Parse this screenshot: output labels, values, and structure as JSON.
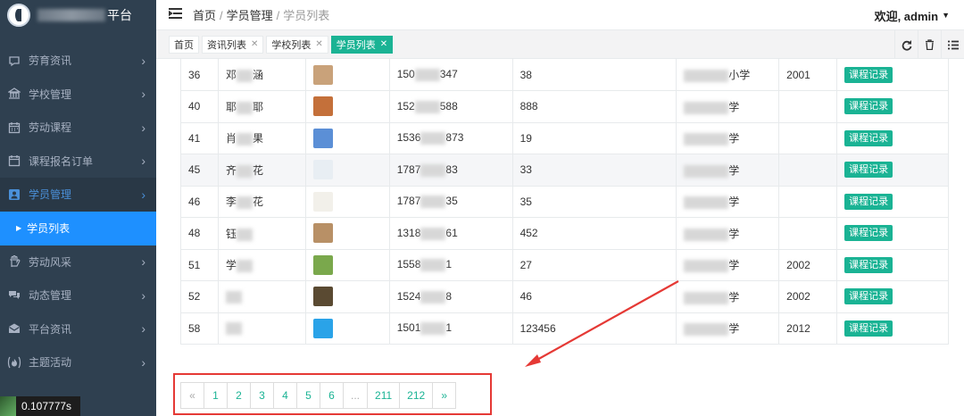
{
  "brand": {
    "title_suffix": "平台"
  },
  "sidebar": {
    "items": [
      {
        "label": "劳育资讯",
        "icon": "chat-bubble-icon"
      },
      {
        "label": "学校管理",
        "icon": "bank-icon"
      },
      {
        "label": "劳动课程",
        "icon": "calendar-icon"
      },
      {
        "label": "课程报名订单",
        "icon": "calendar-icon"
      },
      {
        "label": "学员管理",
        "icon": "user-icon",
        "active": true
      },
      {
        "label": "劳动风采",
        "icon": "hand-icon"
      },
      {
        "label": "动态管理",
        "icon": "comments-icon"
      },
      {
        "label": "平台资讯",
        "icon": "envelope-icon"
      },
      {
        "label": "主题活动",
        "icon": "fire-icon"
      }
    ],
    "submenu": {
      "label": "学员列表"
    },
    "timer": "0.107777s"
  },
  "topbar": {
    "crumbs": [
      "首页",
      "学员管理",
      "学员列表"
    ],
    "welcome": "欢迎, admin"
  },
  "tabs": [
    {
      "label": "首页",
      "closable": false
    },
    {
      "label": "资讯列表",
      "closable": true
    },
    {
      "label": "学校列表",
      "closable": true
    },
    {
      "label": "学员列表",
      "closable": true,
      "active": true
    }
  ],
  "table": {
    "rows": [
      {
        "id": "36",
        "name_a": "邓",
        "name_b": "涵",
        "phone_a": "150",
        "phone_b": "347",
        "score": "38",
        "school_b": "小学",
        "year": "2001",
        "action": "课程记录"
      },
      {
        "id": "40",
        "name_a": "耶",
        "name_b": "耶",
        "phone_a": "152",
        "phone_b": "588",
        "score": "888",
        "school_b": "学",
        "year": "",
        "action": "课程记录"
      },
      {
        "id": "41",
        "name_a": "肖",
        "name_b": "果",
        "phone_a": "1536",
        "phone_b": "873",
        "score": "19",
        "school_b": "学",
        "year": "",
        "action": "课程记录"
      },
      {
        "id": "45",
        "name_a": "齐",
        "name_b": "花",
        "phone_a": "1787",
        "phone_b": "83",
        "score": "33",
        "school_b": "学",
        "year": "",
        "action": "课程记录"
      },
      {
        "id": "46",
        "name_a": "李",
        "name_b": "花",
        "phone_a": "1787",
        "phone_b": "35",
        "score": "35",
        "school_b": "学",
        "year": "",
        "action": "课程记录"
      },
      {
        "id": "48",
        "name_a": "钰",
        "name_b": "",
        "phone_a": "1318",
        "phone_b": "61",
        "score": "452",
        "school_b": "学",
        "year": "",
        "action": "课程记录"
      },
      {
        "id": "51",
        "name_a": "学",
        "name_b": "",
        "phone_a": "1558",
        "phone_b": "1",
        "score": "27",
        "school_b": "学",
        "year": "2002",
        "action": "课程记录"
      },
      {
        "id": "52",
        "name_a": "",
        "name_b": "",
        "phone_a": "1524",
        "phone_b": "8",
        "score": "46",
        "school_b": "学",
        "year": "2002",
        "action": "课程记录"
      },
      {
        "id": "58",
        "name_a": "",
        "name_b": "",
        "phone_a": "1501",
        "phone_b": "1",
        "score": "123456",
        "school_b": "学",
        "year": "2012",
        "action": "课程记录"
      }
    ],
    "avatar_colors": [
      "#c9a27a",
      "#c4703a",
      "#5b8fd6",
      "#e8eef3",
      "#f2f0ea",
      "#b89066",
      "#7aa84c",
      "#5a4a32",
      "#2aa3e8"
    ]
  },
  "pagination": {
    "prev": "«",
    "pages": [
      "1",
      "2",
      "3",
      "4",
      "5",
      "6",
      "...",
      "211",
      "212"
    ],
    "next": "»"
  }
}
